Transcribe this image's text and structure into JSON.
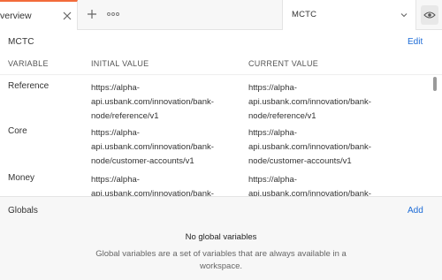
{
  "tabbar": {
    "active_tab_label": "verview",
    "env_selected": "MCTC"
  },
  "environment": {
    "name": "MCTC",
    "edit_label": "Edit",
    "columns": {
      "variable": "VARIABLE",
      "initial": "INITIAL VALUE",
      "current": "CURRENT VALUE"
    },
    "rows": [
      {
        "name": "Reference",
        "initial": [
          "https://alpha-",
          "api.usbank.com/innovation/bank-",
          "node/reference/v1"
        ],
        "current": [
          "https://alpha-",
          "api.usbank.com/innovation/bank-",
          "node/reference/v1"
        ]
      },
      {
        "name": "Core",
        "initial": [
          "https://alpha-",
          "api.usbank.com/innovation/bank-",
          "node/customer-accounts/v1"
        ],
        "current": [
          "https://alpha-",
          "api.usbank.com/innovation/bank-",
          "node/customer-accounts/v1"
        ]
      },
      {
        "name": "Money",
        "initial": [
          "https://alpha-",
          "api.usbank.com/innovation/bank-",
          ""
        ],
        "current": [
          "https://alpha-",
          "api.usbank.com/innovation/bank-",
          ""
        ]
      }
    ]
  },
  "globals": {
    "title": "Globals",
    "add_label": "Add",
    "empty_title": "No global variables",
    "empty_desc": "Global variables are a set of variables that are always available in a workspace."
  },
  "icons": {
    "close": "close-icon",
    "plus": "plus-icon",
    "more": "more-icon",
    "chevron": "chevron-down-icon",
    "eye": "eye-icon"
  },
  "colors": {
    "link": "#1c6bd6",
    "active_tab_accent": "#f26b3a"
  }
}
